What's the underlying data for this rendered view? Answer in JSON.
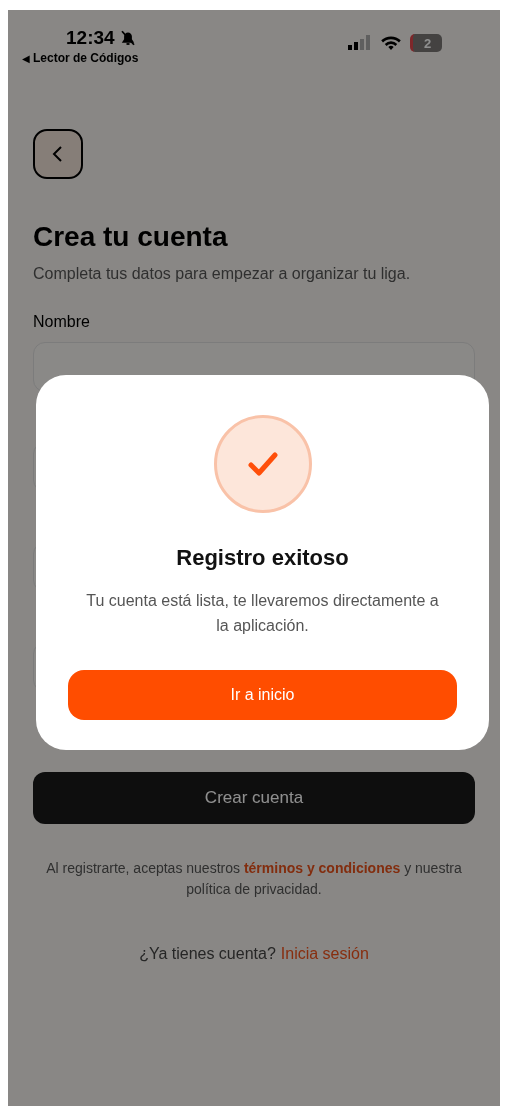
{
  "status_bar": {
    "time": "12:34",
    "silent": true,
    "back_arrow": "◀",
    "back_app": "Lector de Códigos",
    "battery": "2"
  },
  "header": {
    "title": "Crea tu cuenta",
    "subtitle": "Completa tus datos para empezar a organizar tu liga."
  },
  "form": {
    "first_label": "Nombre",
    "submit": "Crear cuenta"
  },
  "legal": {
    "before": "Al registrarte, aceptas nuestros ",
    "link": "términos y condiciones",
    "after": " y nuestra política de privacidad."
  },
  "login": {
    "prompt": "¿Ya tienes cuenta?",
    "link": "Inicia sesión"
  },
  "dialog": {
    "title": "Registro exitoso",
    "message": "Tu cuenta está lista, te llevaremos directamente a la aplicación.",
    "button": "Ir a inicio"
  }
}
